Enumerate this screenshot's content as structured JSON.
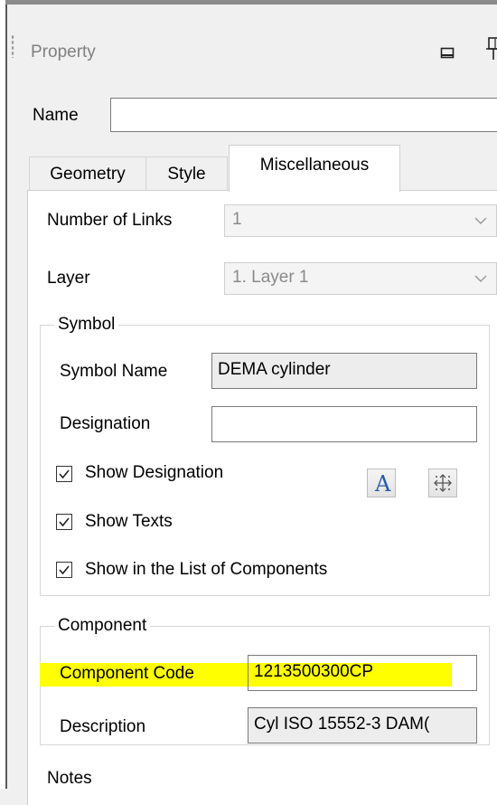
{
  "panel": {
    "title": "Property"
  },
  "name_row": {
    "label": "Name",
    "value": ""
  },
  "tabs": [
    {
      "label": "Geometry",
      "active": false
    },
    {
      "label": "Style",
      "active": false
    },
    {
      "label": "Miscellaneous",
      "active": true
    }
  ],
  "misc": {
    "links": {
      "label": "Number of Links",
      "value": "1"
    },
    "layer": {
      "label": "Layer",
      "value": "1. Layer 1"
    }
  },
  "symbol": {
    "title": "Symbol",
    "name_label": "Symbol Name",
    "name_value": "DEMA cylinder",
    "designation_label": "Designation",
    "designation_value": "",
    "checkboxes": [
      {
        "label": "Show Designation",
        "checked": true
      },
      {
        "label": "Show Texts",
        "checked": true
      },
      {
        "label": "Show in the List of Components",
        "checked": true
      }
    ],
    "font_button_icon": "font-icon",
    "font_button_glyph": "A",
    "position_button_icon": "position-icon"
  },
  "component": {
    "title": "Component",
    "code_label": "Component Code",
    "code_value": "1213500300CP",
    "description_label": "Description",
    "description_value": "Cyl ISO 15552-3 DAM("
  },
  "notes": {
    "label": "Notes"
  },
  "colors": {
    "highlight": "#ffff00",
    "font_button_accent": "#2a5aa8"
  }
}
